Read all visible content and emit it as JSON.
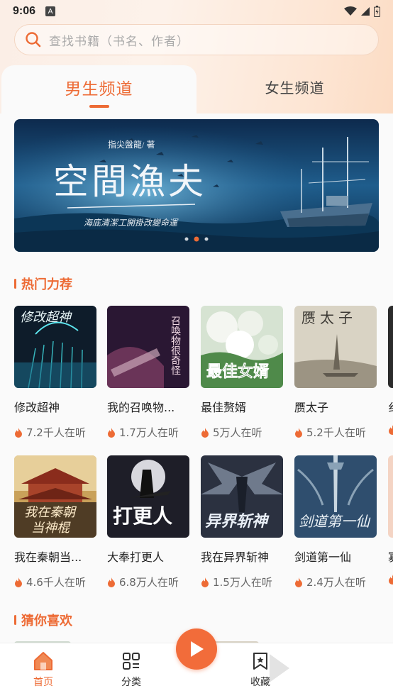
{
  "status": {
    "time": "9:06",
    "a_badge": "A"
  },
  "search": {
    "placeholder": "查找书籍（书名、作者）"
  },
  "tabs": {
    "male": "男生频道",
    "female": "女生频道"
  },
  "banner": {
    "author": "指尖盤龍/ 著",
    "title": "空間漁夫",
    "subtitle": "海底清潔工開掛改變命運",
    "dot_count": 3,
    "active_dot": 2
  },
  "hot": {
    "title": "热门力荐",
    "row1": [
      {
        "title": "修改超神",
        "listeners": "7.2千人在听",
        "cover_text": "修改超神"
      },
      {
        "title": "我的召唤物...",
        "listeners": "1.7万人在听",
        "cover_text": "我的召唤物很奇怪"
      },
      {
        "title": "最佳赘婿",
        "listeners": "5万人在听",
        "cover_text": "最佳女婿"
      },
      {
        "title": "赝太子",
        "listeners": "5.2千人在听",
        "cover_text": "赝太子"
      }
    ],
    "row1_peek": "纟",
    "row2": [
      {
        "title": "我在秦朝当...",
        "listeners": "4.6千人在听",
        "cover_text": "我在秦朝当神棍"
      },
      {
        "title": "大奉打更人",
        "listeners": "6.8万人在听",
        "cover_text": "打更人"
      },
      {
        "title": "我在异界斩神",
        "listeners": "1.5万人在听",
        "cover_text": "异界斩神"
      },
      {
        "title": "剑道第一仙",
        "listeners": "2.4万人在听",
        "cover_text": "剑道第一仙"
      }
    ],
    "row2_peek": "寡"
  },
  "guess": {
    "title": "猜你喜欢"
  },
  "nav": {
    "home": "首页",
    "category": "分类",
    "favorites": "收藏"
  },
  "colors": {
    "accent": "#ed6b35"
  }
}
